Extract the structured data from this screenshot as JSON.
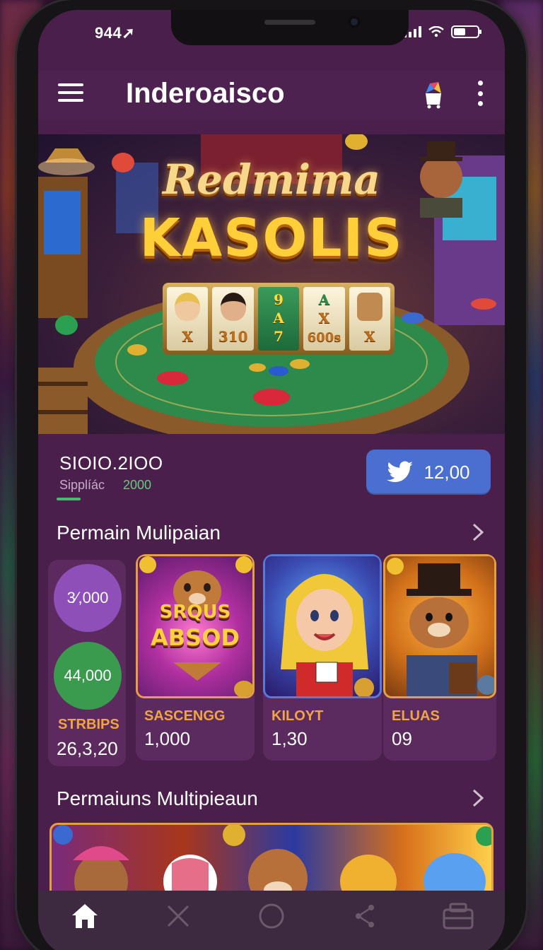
{
  "status_bar": {
    "time": "944"
  },
  "header": {
    "title": "Inderoaisco"
  },
  "banner": {
    "title": "Redmima",
    "subtitle": "KASOLIS",
    "reels": [
      "X",
      "310",
      "7",
      "600s",
      "X"
    ],
    "reel_top": [
      "",
      "",
      "9",
      "A",
      ""
    ],
    "reel_mid": [
      "",
      "",
      "A",
      "X",
      ""
    ]
  },
  "balance": {
    "value": "SIOIO.2IOO",
    "label": "Sipplíác",
    "sub": "2000",
    "action_label": "12,00"
  },
  "section1": {
    "title": "Permain Mulipaian"
  },
  "stats": {
    "circle1": "3⁄,000",
    "circle2": "44,000",
    "name": "STRBIPS",
    "value": "26,3,20"
  },
  "games": [
    {
      "name": "SASCENGG",
      "value": "1,000",
      "art_line1": "SRQUS",
      "art_line2": "ABSOD"
    },
    {
      "name": "KILOYT",
      "value": "1,30"
    },
    {
      "name": "ELUAS",
      "value": "09"
    }
  ],
  "section2": {
    "title": "Permaiuns Multipieaun"
  },
  "colors": {
    "accent": "#4a6fd0",
    "background": "#4a1f4c",
    "gold": "#f0a544"
  },
  "icons": [
    "menu-icon",
    "cart-icon",
    "more-icon",
    "twitter-icon",
    "chevron-right-icon",
    "home-icon",
    "tools-icon",
    "circle-icon",
    "share-icon",
    "wallet-icon"
  ]
}
